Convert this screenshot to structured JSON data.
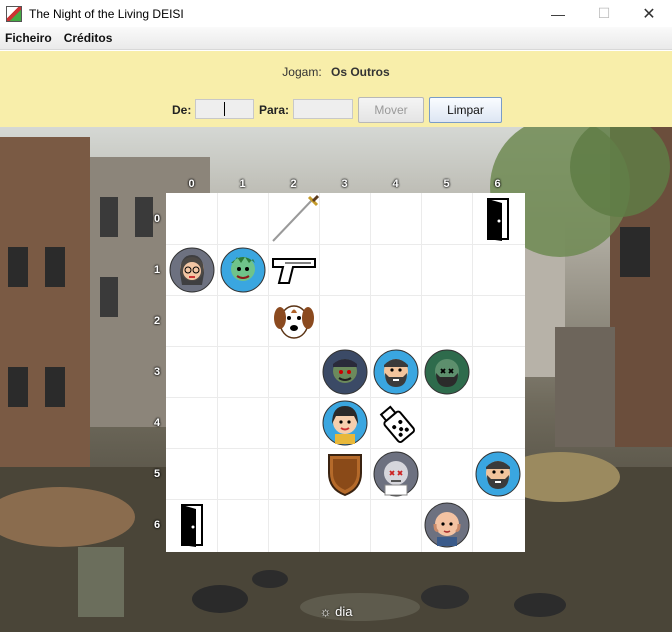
{
  "window": {
    "title": "The Night of the Living DEISI"
  },
  "menu": {
    "items": [
      "Ficheiro",
      "Créditos"
    ]
  },
  "turn": {
    "label": "Jogam:",
    "value": "Os Outros"
  },
  "controls": {
    "from_label": "De:",
    "to_label": "Para:",
    "from_value": "",
    "to_value": "",
    "move_label": "Mover",
    "clear_label": "Limpar"
  },
  "board": {
    "columns": [
      "0",
      "1",
      "2",
      "3",
      "4",
      "5",
      "6"
    ],
    "rows": [
      "0",
      "1",
      "2",
      "3",
      "4",
      "5",
      "6"
    ],
    "pieces": [
      {
        "col": 2,
        "row": 0,
        "kind": "sword"
      },
      {
        "col": 6,
        "row": 0,
        "kind": "door"
      },
      {
        "col": 0,
        "row": 1,
        "kind": "human-woman-glasses"
      },
      {
        "col": 1,
        "row": 1,
        "kind": "zombie-green-hair"
      },
      {
        "col": 2,
        "row": 1,
        "kind": "pistol"
      },
      {
        "col": 2,
        "row": 2,
        "kind": "dog"
      },
      {
        "col": 3,
        "row": 3,
        "kind": "zombie-dark"
      },
      {
        "col": 4,
        "row": 3,
        "kind": "human-bearded"
      },
      {
        "col": 5,
        "row": 3,
        "kind": "zombie-bearded"
      },
      {
        "col": 3,
        "row": 4,
        "kind": "human-woman"
      },
      {
        "col": 4,
        "row": 4,
        "kind": "spray-bottle"
      },
      {
        "col": 3,
        "row": 5,
        "kind": "shield"
      },
      {
        "col": 4,
        "row": 5,
        "kind": "zombie-pale"
      },
      {
        "col": 6,
        "row": 5,
        "kind": "human-bearded"
      },
      {
        "col": 0,
        "row": 6,
        "kind": "door"
      },
      {
        "col": 5,
        "row": 6,
        "kind": "human-bald"
      }
    ]
  },
  "status": {
    "day_label": "☼ dia"
  },
  "colors": {
    "panel": "#f8eeaa",
    "board": "#ffffff"
  }
}
